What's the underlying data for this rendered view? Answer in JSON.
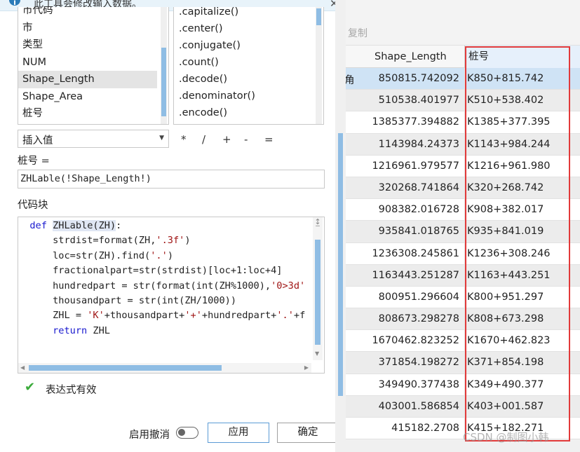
{
  "info": {
    "text": "此工具会修改输入数据。"
  },
  "fields": [
    "市代码",
    "市",
    "类型",
    "NUM",
    "Shape_Length",
    "Shape_Area",
    "桩号"
  ],
  "selected_field": "Shape_Length",
  "methods": [
    ".capitalize()",
    ".center()",
    ".conjugate()",
    ".count()",
    ".decode()",
    ".denominator()",
    ".encode()"
  ],
  "insert_combo": {
    "label": "插入值"
  },
  "operators": [
    "*",
    "/",
    "+",
    "-",
    "="
  ],
  "expression": {
    "label": "桩号 =",
    "value": "ZHLable(!Shape_Length!)"
  },
  "code_block": {
    "label": "代码块",
    "lines": [
      "def ZHLable(ZH):",
      "    strdist=format(ZH,'.3f')",
      "    loc=str(ZH).find('.')",
      "    fractionalpart=str(strdist)[loc+1:loc+4]",
      "    hundredpart = str(format(int(ZH%1000),'0>3d'",
      "    thousandpart = str(int(ZH/1000))",
      "    ZHL = 'K'+thousandpart+'+'+hundredpart+'.'+f",
      "    return ZHL"
    ]
  },
  "validation": {
    "text": "表达式有效"
  },
  "footer": {
    "undo_label": "启用撤消",
    "apply_label": "应用",
    "ok_label": "确定"
  },
  "table": {
    "toolbar_copy": "复制",
    "columns": [
      "Shape_Length",
      "桩号"
    ],
    "cut_text": "角",
    "rows": [
      {
        "shape_length": "850815.742092",
        "zh": "K850+815.742"
      },
      {
        "shape_length": "510538.401977",
        "zh": "K510+538.402"
      },
      {
        "shape_length": "1385377.394882",
        "zh": "K1385+377.395"
      },
      {
        "shape_length": "1143984.24373",
        "zh": "K1143+984.244"
      },
      {
        "shape_length": "1216961.979577",
        "zh": "K1216+961.980"
      },
      {
        "shape_length": "320268.741864",
        "zh": "K320+268.742"
      },
      {
        "shape_length": "908382.016728",
        "zh": "K908+382.017"
      },
      {
        "shape_length": "935841.018765",
        "zh": "K935+841.019"
      },
      {
        "shape_length": "1236308.245861",
        "zh": "K1236+308.246"
      },
      {
        "shape_length": "1163443.251287",
        "zh": "K1163+443.251"
      },
      {
        "shape_length": "800951.296604",
        "zh": "K800+951.297"
      },
      {
        "shape_length": "808673.298278",
        "zh": "K808+673.298"
      },
      {
        "shape_length": "1670462.823252",
        "zh": "K1670+462.823"
      },
      {
        "shape_length": "371854.198272",
        "zh": "K371+854.198"
      },
      {
        "shape_length": "349490.377438",
        "zh": "K349+490.377"
      },
      {
        "shape_length": "403001.586854",
        "zh": "K403+001.587"
      },
      {
        "shape_length": "415182.2708",
        "zh": "K415+182.271"
      }
    ]
  },
  "watermark": "CSDN @制图小韩",
  "colors": {
    "accent": "#8fbde4",
    "selection": "#cfe3f5",
    "highlight_box": "#e23a3a",
    "valid": "#3bab3b"
  }
}
